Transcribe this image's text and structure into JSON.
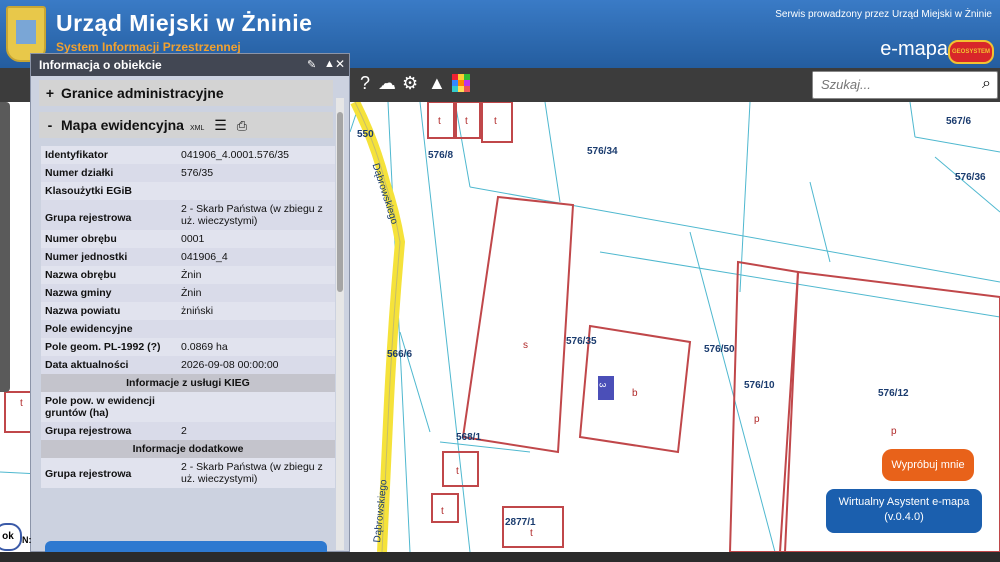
{
  "header": {
    "title": "Urząd Miejski w Żninie",
    "subtitle": "System Informacji Przestrzennej",
    "serwis": "Serwis prowadzony przez Urząd Miejski w Żninie",
    "brand": "e-mapa",
    "geo_badge": "GEOSYSTEM"
  },
  "toolbar": {
    "search_placeholder": "Szukaj...",
    "icons": [
      "help-icon",
      "cloud-upload-icon",
      "settings-icon",
      "road-icon",
      "color-grid-icon"
    ]
  },
  "panel": {
    "title": "Informacja o obiekcie",
    "section1": {
      "symbol": "+",
      "label": "Granice administracyjne"
    },
    "section2": {
      "symbol": "-",
      "label": "Mapa ewidencyjna",
      "xml": "XML"
    },
    "rows": [
      {
        "label": "Identyfikator",
        "value": "041906_4.0001.576/35"
      },
      {
        "label": "Numer działki",
        "value": "576/35"
      },
      {
        "label": "Klasoużytki EGiB",
        "value": ""
      },
      {
        "label": "Grupa rejestrowa",
        "value": "2 - Skarb Państwa (w zbiegu z uż. wieczystymi)"
      },
      {
        "label": "Numer obrębu",
        "value": "0001"
      },
      {
        "label": "Numer jednostki",
        "value": "041906_4"
      },
      {
        "label": "Nazwa obrębu",
        "value": "Żnin"
      },
      {
        "label": "Nazwa gminy",
        "value": "Żnin"
      },
      {
        "label": "Nazwa powiatu",
        "value": "żniński"
      },
      {
        "label": "Pole ewidencyjne",
        "value": ""
      },
      {
        "label": "Pole geom. PL-1992 (?)",
        "value": "0.0869 ha"
      },
      {
        "label": "Data aktualności",
        "value": "2026-09-08 00:00:00"
      }
    ],
    "kieg_header": "Informacje z usługi KIEG",
    "kieg_rows": [
      {
        "label": "Pole pow. w ewidencji gruntów (ha)",
        "value": ""
      },
      {
        "label": "Grupa rejestrowa",
        "value": "2"
      }
    ],
    "extra_header": "Informacje dodatkowe",
    "extra_rows": [
      {
        "label": "Grupa rejestrowa",
        "value": "2 - Skarb Państwa (w zbiegu z uż. wieczystymi)"
      }
    ]
  },
  "map": {
    "street": "Dąbrowskiego",
    "parcels": [
      "550",
      "576/8",
      "576/34",
      "567/6",
      "576/36",
      "576/35",
      "576/50",
      "576/10",
      "576/12",
      "566/6",
      "568/1",
      "2877/1"
    ],
    "building_marks": [
      "t",
      "s",
      "b",
      "p",
      "3"
    ]
  },
  "assistant": {
    "try_label": "Wypróbuj mnie",
    "name": "Wirtualny Asystent e-mapa",
    "version": "(v.0.4.0)"
  },
  "corner": {
    "ok": "ok",
    "n": "N:"
  }
}
